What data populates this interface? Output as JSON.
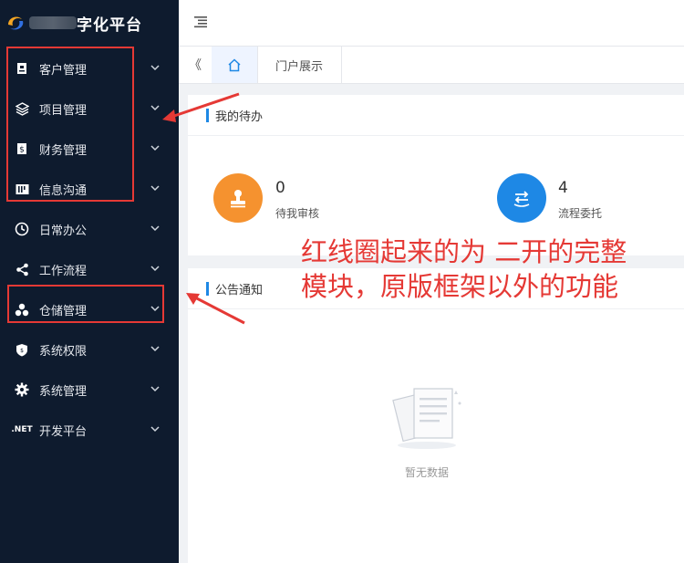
{
  "brand": {
    "title": "字化平台",
    "logo_icon": "swirl-logo"
  },
  "sidebar": {
    "items": [
      {
        "label": "客户管理",
        "icon": "contacts-icon"
      },
      {
        "label": "项目管理",
        "icon": "layers-icon"
      },
      {
        "label": "财务管理",
        "icon": "dollar-icon"
      },
      {
        "label": "信息沟通",
        "icon": "chat-icon"
      },
      {
        "label": "日常办公",
        "icon": "clock-icon"
      },
      {
        "label": "工作流程",
        "icon": "share-icon"
      },
      {
        "label": "仓储管理",
        "icon": "boxes-icon"
      },
      {
        "label": "系统权限",
        "icon": "shield-icon"
      },
      {
        "label": "系统管理",
        "icon": "gear-icon"
      },
      {
        "label": "开发平台",
        "icon": "dotnet-icon",
        "icon_text": ".NET"
      }
    ]
  },
  "tabs": {
    "collapse_glyph": "《",
    "items": [
      {
        "label": "门户展示"
      }
    ]
  },
  "todo": {
    "title": "我的待办",
    "stats": [
      {
        "value": "0",
        "label": "待我审核",
        "color": "#f5922f"
      },
      {
        "value": "4",
        "label": "流程委托",
        "color": "#1e88e5"
      }
    ]
  },
  "notice": {
    "title": "公告通知",
    "empty_text": "暂无数据"
  },
  "annotation": {
    "line1": "红线圈起来的为 二开的完整",
    "line2": "模块，原版框架以外的功能",
    "color": "#e53935"
  },
  "colors": {
    "sidebar_bg": "#0e1b2e",
    "accent": "#1e88e5"
  }
}
